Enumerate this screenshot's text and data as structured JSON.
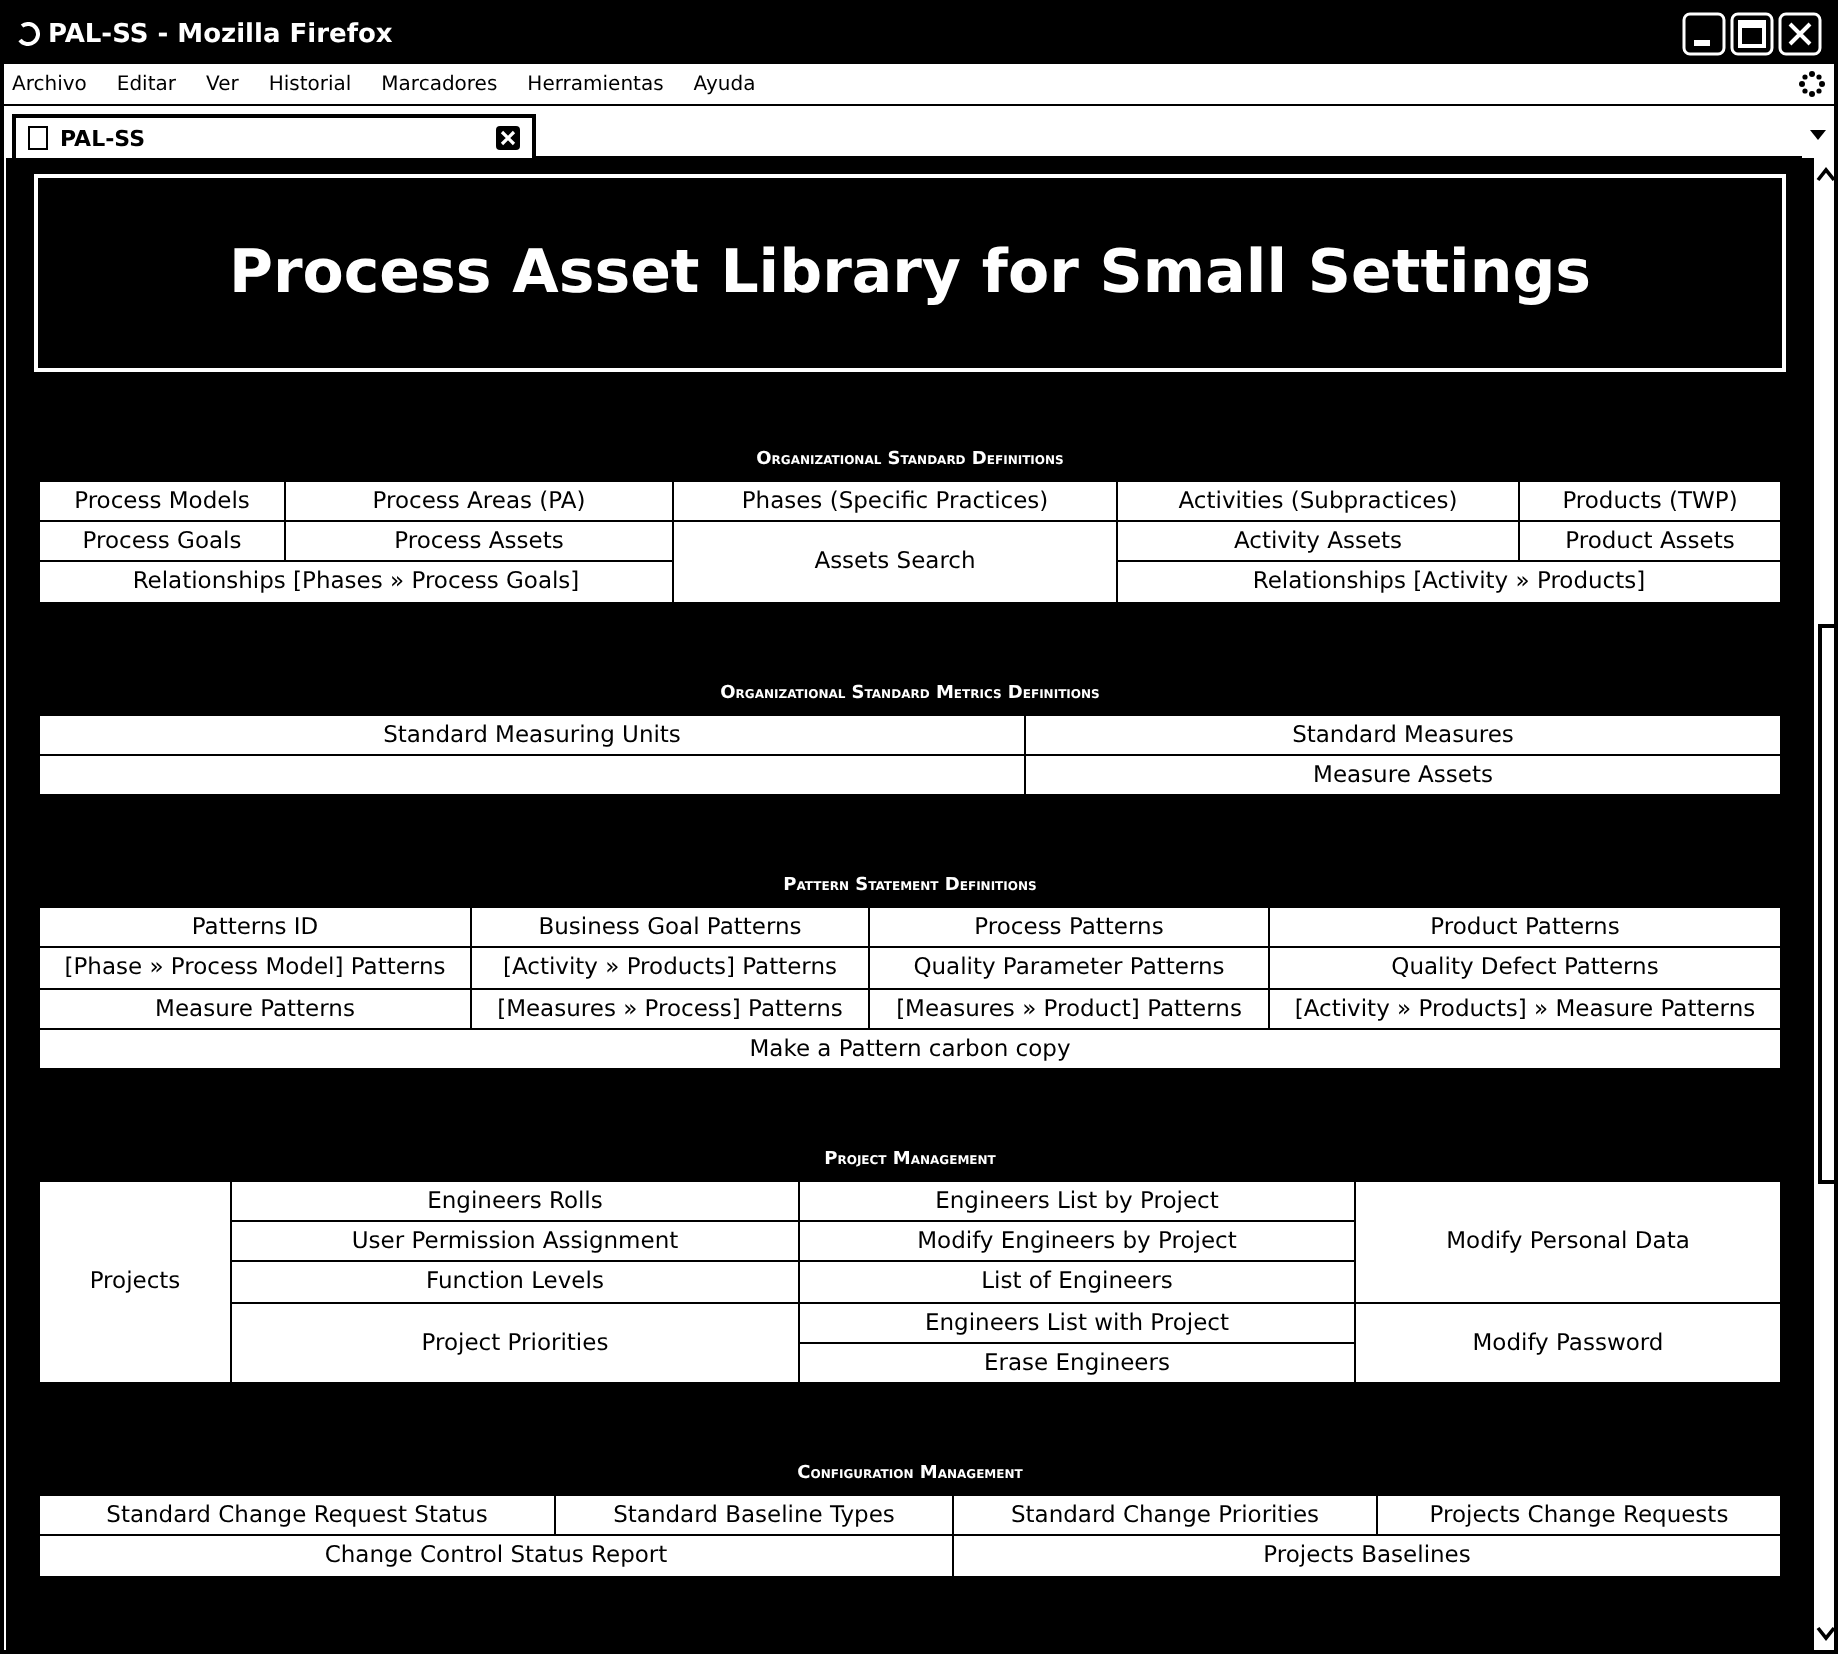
{
  "window": {
    "title": "PAL-SS - Mozilla Firefox"
  },
  "menu": [
    "Archivo",
    "Editar",
    "Ver",
    "Historial",
    "Marcadores",
    "Herramientas",
    "Ayuda"
  ],
  "tabs": [
    {
      "label": "PAL-SS",
      "selected": true
    }
  ],
  "banner": "Process Asset Library for Small Settings",
  "sections": [
    {
      "title": "Organizational Standard Definitions",
      "rows": [
        [
          {
            "text": "Process Models"
          },
          {
            "text": "Process Areas (PA)"
          },
          {
            "text": "Phases (Specific Practices)"
          },
          {
            "text": "Activities (Subpractices)"
          },
          {
            "text": "Products (TWP)"
          }
        ],
        [
          {
            "text": "Process Goals"
          },
          {
            "text": "Process Assets"
          },
          {
            "text": "Assets Search",
            "rowspan": 2
          },
          {
            "text": "Activity Assets"
          },
          {
            "text": "Product Assets"
          }
        ],
        [
          {
            "text": "Relationships [Phases » Process Goals]",
            "colspan": 2
          },
          {
            "text": "Relationships [Activity » Products]",
            "colspan": 2
          }
        ]
      ]
    },
    {
      "title": "Organizational Standard Metrics Definitions",
      "rows": [
        [
          {
            "text": "Standard Measuring Units"
          },
          {
            "text": "Standard Measures"
          }
        ],
        [
          {},
          {
            "text": "Measure Assets"
          }
        ]
      ]
    },
    {
      "title": "Pattern Statement Definitions",
      "rows": [
        [
          {
            "text": "Patterns ID"
          },
          {
            "text": "Business Goal Patterns"
          },
          {
            "text": "Process Patterns"
          },
          {
            "text": "Product Patterns"
          }
        ],
        [
          {
            "text": "[Phase » Process Model] Patterns"
          },
          {
            "text": "[Activity » Products] Patterns"
          },
          {
            "text": "Quality Parameter Patterns"
          },
          {
            "text": "Quality Defect Patterns"
          }
        ],
        [
          {
            "text": "Measure Patterns"
          },
          {
            "text": "[Measures » Process] Patterns"
          },
          {
            "text": "[Measures » Product] Patterns"
          },
          {
            "text": "[Activity » Products] » Measure Patterns"
          }
        ],
        [
          {
            "text": "Make a Pattern carbon copy",
            "colspan": 4
          }
        ]
      ]
    },
    {
      "title": "Project Management",
      "rows": [
        [
          {
            "text": "Projects",
            "rowspan": 5
          },
          {
            "text": "Engineers Rolls"
          },
          {
            "text": "Engineers List by Project"
          },
          {
            "text": "Modify Personal Data",
            "rowspan": 3
          }
        ],
        [
          {
            "text": "User Permission Assignment"
          },
          {
            "text": "Modify Engineers by Project"
          }
        ],
        [
          {
            "text": "Function Levels"
          },
          {
            "text": "List of Engineers"
          }
        ],
        [
          {
            "text": "Project Priorities",
            "rowspan": 2
          },
          {
            "text": "Engineers List with Project"
          },
          {
            "text": "Modify Password",
            "rowspan": 2
          }
        ],
        [
          {
            "text": "Erase Engineers"
          }
        ]
      ]
    },
    {
      "title": "Configuration Management",
      "rows": [
        [
          {
            "text": "Standard Change Request Status"
          },
          {
            "text": "Standard Baseline Types"
          },
          {
            "text": "Standard Change Priorities"
          },
          {
            "text": "Projects Change Requests"
          }
        ],
        [
          {
            "text": "Change Control Status Report",
            "colspan": 2
          },
          {
            "text": "Projects Baselines",
            "colspan": 2
          }
        ]
      ]
    }
  ]
}
